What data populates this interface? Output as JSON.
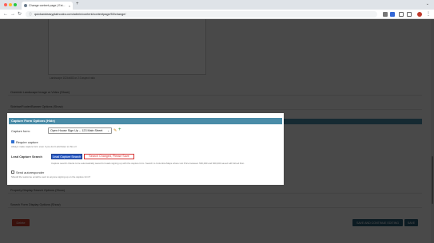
{
  "browser": {
    "tab_title": "Change content page | Ext...",
    "tab_close": "×",
    "new_tab": "+",
    "tab_menu": "⌄",
    "nav_back": "←",
    "nav_forward": "→",
    "nav_reload": "↻",
    "url_icon": "ⓘ",
    "url": "quickandeasyplatnooks.com/admin/content/contentpage/53/change/",
    "menu": "⋮"
  },
  "page": {
    "preview_note": "Landscape 1024x683 or 2:3 aspect ratio",
    "sections": {
      "landscape": "Override Landscape Image or Video (Show)",
      "owner": "Sidebar/Footer/Banner Options (Show)",
      "property_search": "Property Display Search Options (Show)",
      "search_form": "Search Form Display Options (Show)"
    },
    "buttons": {
      "delete": "Delete",
      "save_continue": "SAVE AND CONTINUE EDITING",
      "save": "SAVE"
    }
  },
  "panel": {
    "title": "Capture Form Options (Hide)",
    "capture_form_label": "Capture form:",
    "capture_form_value": "Open House Sign Up -- 123 Main Street",
    "select_arrow": "⌄",
    "edit_icon": "✎",
    "add_icon": "+",
    "require_label": "Require capture",
    "require_hint": "Always make capture form even if you don't add listen to this url",
    "lead_label": "Lead Capture Search",
    "lead_button": "Lead Capture Search",
    "changed_button": "Search Changed, Please Save",
    "lead_hint": "Capture search criteria to be automatically saved for leads signing up with the capture form. Search to Columbia Maps where List Price between 500,000 and 600,000 saved with Wood Run.",
    "autoresponder_label": "Send autoresponder",
    "autoresponder_hint": "Should the welcome email be sent to anyone signing up on the capture form?"
  },
  "colors": {
    "section_bar": "#4a8ca8",
    "primary_button": "#2f5fc8",
    "danger": "#c0392b",
    "dark_button": "#2b5a73",
    "alert_text": "#d63333"
  }
}
